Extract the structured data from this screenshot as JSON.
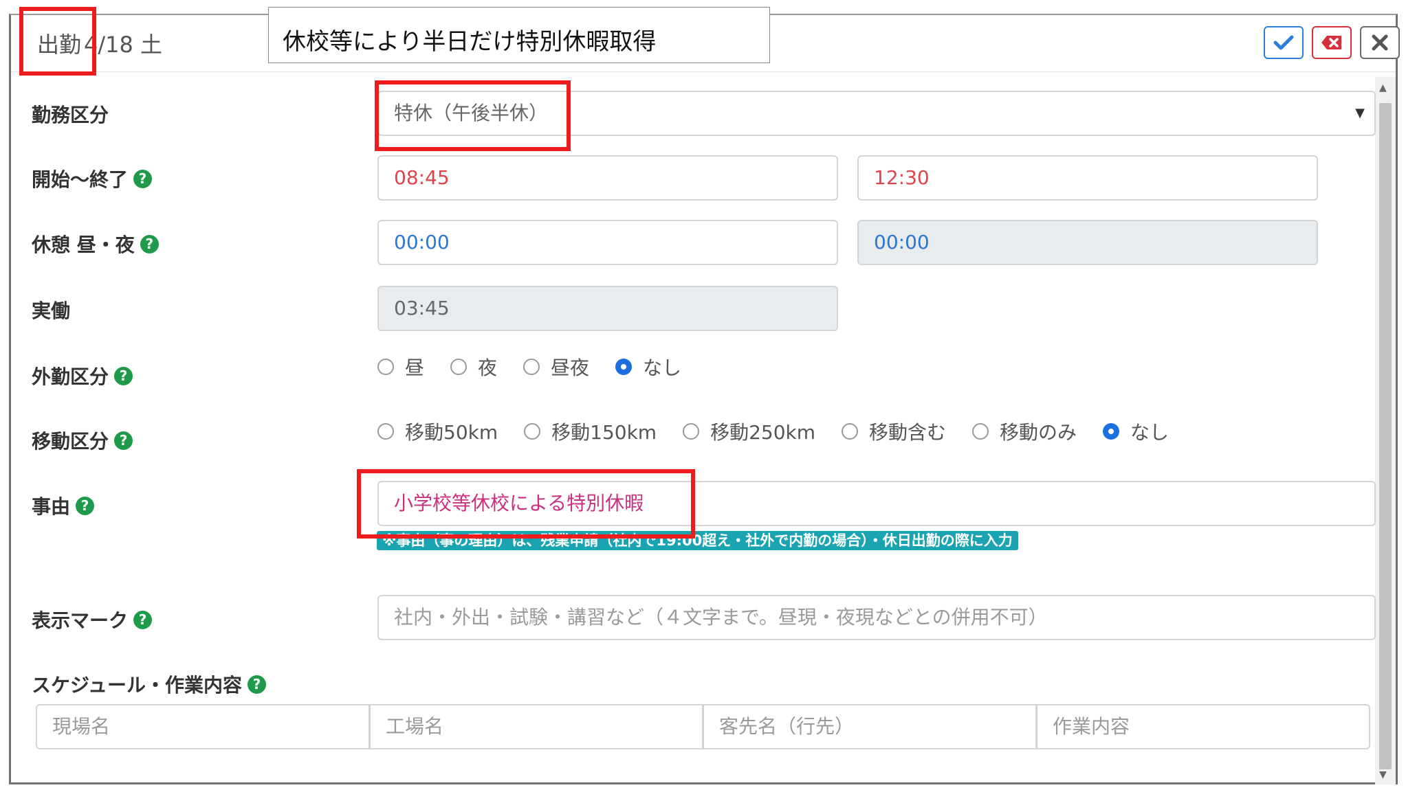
{
  "header": {
    "prefix": "出勤",
    "date": "4/18 土",
    "confirm_icon": "check-icon",
    "delete_icon": "delete-icon",
    "close_icon": "close-icon"
  },
  "annotation": {
    "text": "休校等により半日だけ特別休暇取得"
  },
  "form": {
    "work_type": {
      "label": "勤務区分",
      "value": "特休（午後半休）"
    },
    "time": {
      "label": "開始～終了",
      "start": "08:45",
      "end": "12:30"
    },
    "break": {
      "label": "休憩 昼・夜",
      "day": "00:00",
      "night": "00:00"
    },
    "actual": {
      "label": "実働",
      "value": "03:45"
    },
    "outside": {
      "label": "外勤区分",
      "options": [
        "昼",
        "夜",
        "昼夜",
        "なし"
      ],
      "selected": "なし"
    },
    "travel": {
      "label": "移動区分",
      "options": [
        "移動50km",
        "移動150km",
        "移動250km",
        "移動含む",
        "移動のみ",
        "なし"
      ],
      "selected": "なし"
    },
    "reason": {
      "label": "事由",
      "value": "小学校等休校による特別休暇",
      "note": "※事由（事の理由）は、残業申請（社内で19:00超え・社外で内勤の場合）・休日出勤の際に入力"
    },
    "mark": {
      "label": "表示マーク",
      "placeholder": "社内・外出・試験・講習など（４文字まで。昼現・夜現などとの併用不可）"
    },
    "schedule": {
      "label": "スケジュール・作業内容",
      "placeholders": [
        "現場名",
        "工場名",
        "客先名（行先）",
        "作業内容"
      ]
    },
    "help_symbol": "?"
  },
  "colors": {
    "accent_blue": "#1d6fe0",
    "danger": "#d6303d",
    "help_green": "#1f9a4a",
    "note_teal": "#1aa3b0",
    "highlight_red": "#ee1c1c"
  }
}
